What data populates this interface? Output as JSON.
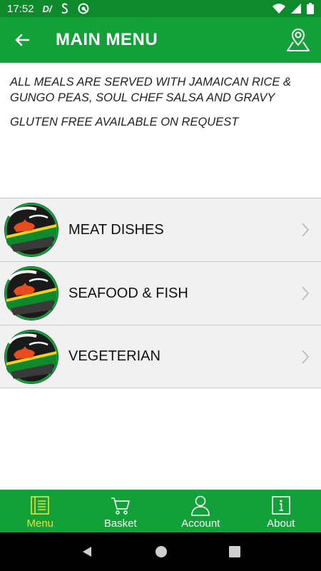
{
  "status_bar": {
    "time": "17:52",
    "left_icons": [
      "dv-app-icon",
      "s-app-icon",
      "notification-icon"
    ],
    "right_icons": [
      "wifi-icon",
      "signal-icon",
      "battery-icon"
    ]
  },
  "app_bar": {
    "title": "MAIN MENU",
    "back_icon": "back-arrow-icon",
    "map_icon": "map-location-icon"
  },
  "info": {
    "line1": "ALL MEALS ARE SERVED WITH JAMAICAN RICE & GUNGO PEAS, SOUL CHEF SALSA AND GRAVY",
    "line2": "GLUTEN FREE AVAILABLE ON REQUEST"
  },
  "menu_items": [
    {
      "label": "MEAT DISHES",
      "logo": "soulchef-kitchen-logo"
    },
    {
      "label": "SEAFOOD & FISH",
      "logo": "soulchef-kitchen-logo"
    },
    {
      "label": "VEGETERIAN",
      "logo": "soulchef-kitchen-logo"
    }
  ],
  "bottom_nav": {
    "items": [
      {
        "label": "Menu",
        "icon": "menu-book-icon",
        "active": true
      },
      {
        "label": "Basket",
        "icon": "cart-icon",
        "active": false
      },
      {
        "label": "Account",
        "icon": "person-icon",
        "active": false
      },
      {
        "label": "About",
        "icon": "info-icon",
        "active": false
      }
    ]
  },
  "colors": {
    "app_bar": "#12a038",
    "status_bar": "#0e8a2c",
    "active_nav": "#e8e13a",
    "row_bg": "#f1f1f1"
  }
}
